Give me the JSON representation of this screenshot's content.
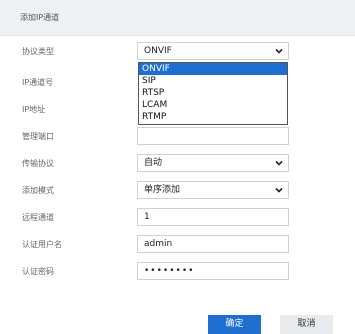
{
  "dialog": {
    "title": "添加IP通道"
  },
  "form": {
    "protocol_label": "协议类型",
    "protocol_value": "ONVIF",
    "protocol_options": [
      "ONVIF",
      "SIP",
      "RTSP",
      "LCAM",
      "RTMP"
    ],
    "ip_channel_label": "IP通道号",
    "ip_address_label": "IP地址",
    "mgmt_port_label": "管理端口",
    "transport_label": "传输协议",
    "transport_value": "自动",
    "add_mode_label": "添加模式",
    "add_mode_value": "单序添加",
    "remote_channel_label": "远程通道",
    "remote_channel_value": "1",
    "username_label": "认证用户名",
    "username_value": "admin",
    "password_label": "认证密码",
    "password_value": "••••••••"
  },
  "buttons": {
    "ok": "确定",
    "cancel": "取消"
  },
  "colors": {
    "accent": "#1e6fd0",
    "header_bg": "#eef0f3"
  }
}
